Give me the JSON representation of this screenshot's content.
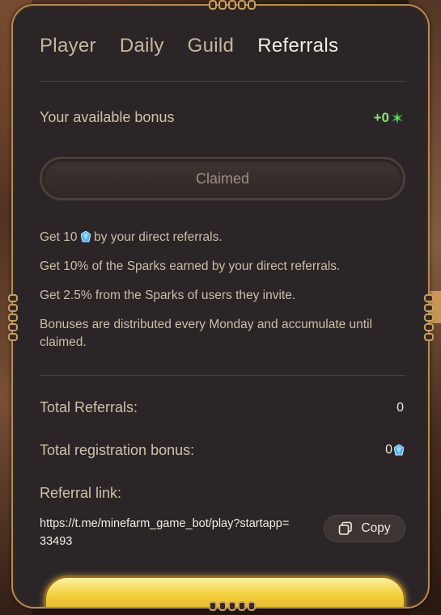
{
  "tabs": [
    {
      "label": "Player"
    },
    {
      "label": "Daily"
    },
    {
      "label": "Guild"
    },
    {
      "label": "Referrals",
      "active": true
    }
  ],
  "bonus": {
    "label": "Your available bonus",
    "value": "+0",
    "value_icon": "spark-icon",
    "claim_button": "Claimed"
  },
  "info": {
    "line1_prefix": "Get 10",
    "line1_icon": "gem-icon",
    "line1_suffix": " by your direct referrals.",
    "line2": "Get 10% of the Sparks earned by your direct referrals.",
    "line3": "Get 2.5% from the Sparks of users they invite.",
    "line4": "Bonuses are distributed every Monday and accumulate until claimed."
  },
  "stats": {
    "total_referrals_label": "Total Referrals:",
    "total_referrals_value": "0",
    "registration_bonus_label": "Total registration bonus:",
    "registration_bonus_value": "0",
    "registration_bonus_icon": "gem-icon"
  },
  "referral": {
    "label": "Referral link:",
    "url": "https://t.me/minefarm_game_bot/play?startapp=33493",
    "copy_label": "Copy"
  },
  "colors": {
    "panel_bg": "#2b2528",
    "border_gold": "#b58a55",
    "bonus_green": "#8ee07a",
    "gem_blue": "#4fb3f0",
    "active_tab": "#f2ece0",
    "inactive_tab": "#c6b79c"
  }
}
